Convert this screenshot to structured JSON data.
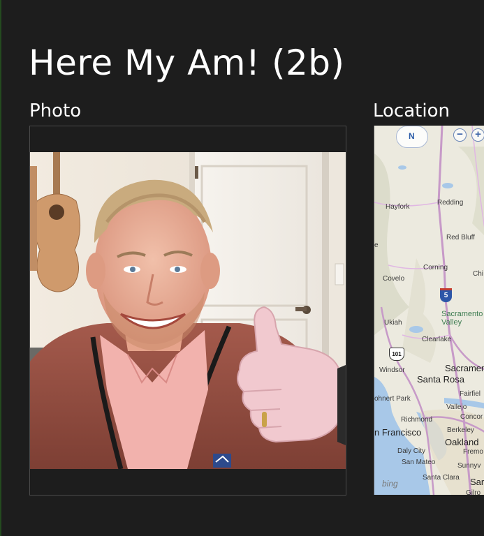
{
  "app": {
    "title": "Here My Am! (2b)"
  },
  "sections": {
    "photo_label": "Photo",
    "location_label": "Location"
  },
  "map": {
    "compass_label": "N",
    "zoom_out_label": "−",
    "zoom_in_label": "+",
    "logo": "bing",
    "highway_shields": [
      "5",
      "101"
    ],
    "places": [
      "Hayfork",
      "Redding",
      "Red Bluff",
      "Corning",
      "Covelo",
      "Chi",
      "Sacramento Valley",
      "Ukiah",
      "Clearlake",
      "Windsor",
      "Sacrament",
      "Santa Rosa",
      "Fairfiel",
      "ohnert Park",
      "Vallejo",
      "Richmond",
      "Concor",
      "Berkeley",
      "n Francisco",
      "Oakland",
      "Daly City",
      "Fremo",
      "San Mateo",
      "Sunnyv",
      "Santa Clara",
      "Sar",
      "Gilro",
      "e"
    ]
  },
  "colors": {
    "background": "#1d1d1d",
    "title_text": "#ffffff",
    "map_land": "#eceadf",
    "map_water": "#a8c8e8",
    "map_highway": "#c79ac8"
  }
}
